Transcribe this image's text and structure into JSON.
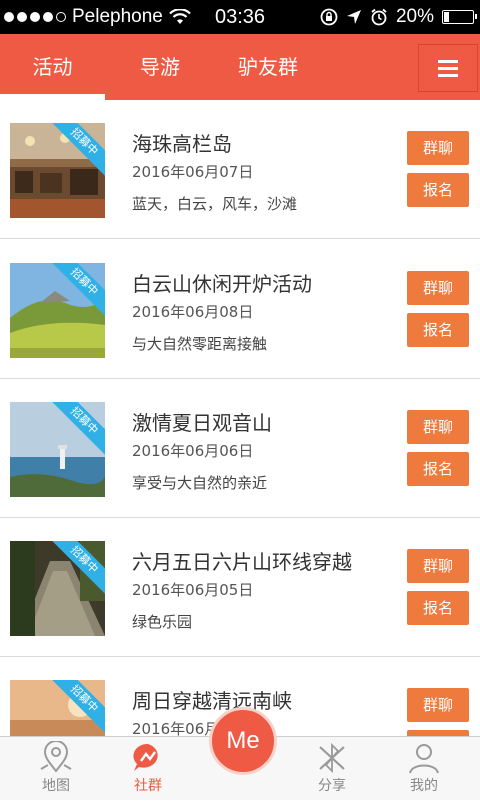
{
  "status_bar": {
    "carrier": "Pelephone",
    "time": "03:36",
    "battery": "20%",
    "battery_level": 0.2
  },
  "tabs": [
    {
      "label": "活动",
      "active": true
    },
    {
      "label": "导游",
      "active": false
    },
    {
      "label": "驴友群",
      "active": false
    }
  ],
  "menu_icon": "hamburger-menu-icon",
  "badge_text": "招募中",
  "activities": [
    {
      "title": "海珠高栏岛",
      "date": "2016年06月07日",
      "desc": "蓝天，白云，风车，沙滩",
      "chat": "群聊",
      "signup": "报名"
    },
    {
      "title": "白云山休闲开炉活动",
      "date": "2016年06月08日",
      "desc": "与大自然零距离接触",
      "chat": "群聊",
      "signup": "报名"
    },
    {
      "title": "激情夏日观音山",
      "date": "2016年06月06日",
      "desc": "享受与大自然的亲近",
      "chat": "群聊",
      "signup": "报名"
    },
    {
      "title": "六月五日六片山环线穿越",
      "date": "2016年06月05日",
      "desc": "绿色乐园",
      "chat": "群聊",
      "signup": "报名"
    },
    {
      "title": "周日穿越清远南峡",
      "date": "2016年06月",
      "desc": "",
      "chat": "群聊",
      "signup": "报名"
    }
  ],
  "bottom_nav": [
    {
      "label": "地图",
      "icon": "map-pin-icon",
      "active": false
    },
    {
      "label": "社群",
      "icon": "community-icon",
      "active": true
    },
    {
      "label": "分享",
      "icon": "share-icon",
      "active": false
    },
    {
      "label": "我的",
      "icon": "profile-icon",
      "active": false
    }
  ],
  "center_button": "Me",
  "colors": {
    "accent": "#ef5a44",
    "button": "#ee7a3e",
    "badge": "#2fb0e6"
  }
}
